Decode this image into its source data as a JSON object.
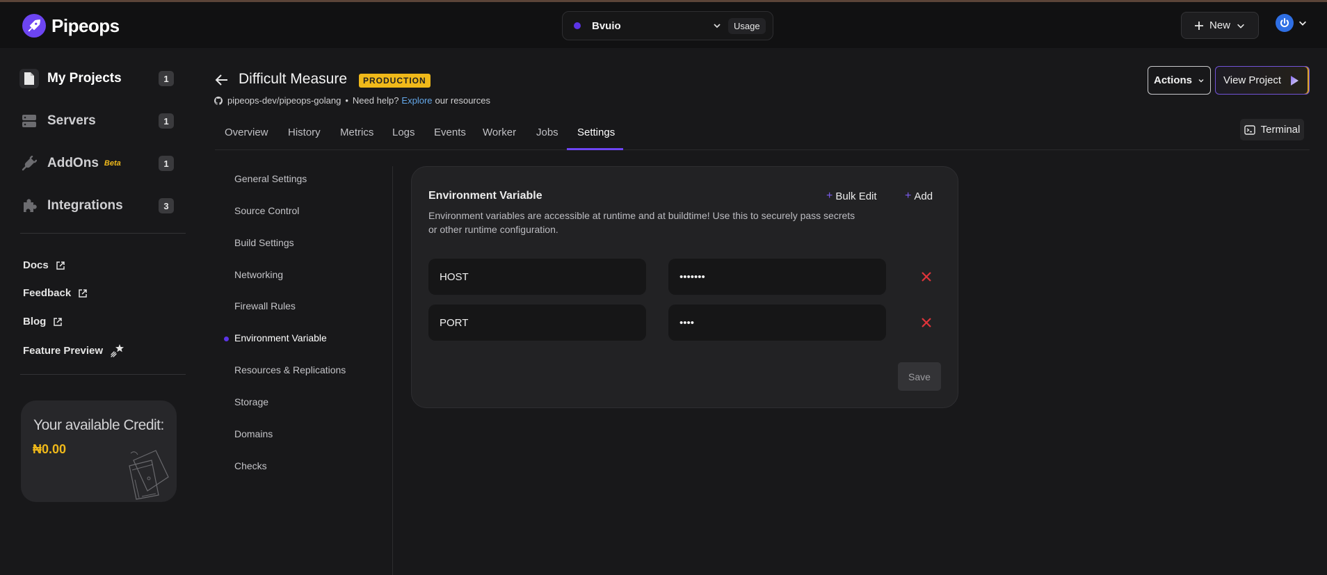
{
  "app": {
    "name": "Pipeops"
  },
  "header": {
    "workspace": "Bvuio",
    "usage_label": "Usage",
    "new_label": "New"
  },
  "sidebar": {
    "items": [
      {
        "label": "My Projects",
        "count": "1"
      },
      {
        "label": "Servers",
        "count": "1"
      },
      {
        "label": "AddOns",
        "badge": "Beta",
        "count": "1"
      },
      {
        "label": "Integrations",
        "count": "3"
      }
    ],
    "links": [
      {
        "label": "Docs"
      },
      {
        "label": "Feedback"
      },
      {
        "label": "Blog"
      },
      {
        "label": "Feature Preview"
      }
    ],
    "credit": {
      "title": "Your available Credit:",
      "value": "₦0.00"
    }
  },
  "project": {
    "title": "Difficult Measure",
    "env_badge": "PRODUCTION",
    "repo": "pipeops-dev/pipeops-golang",
    "help_prefix": "Need help?",
    "help_link": "Explore",
    "help_suffix": "our resources",
    "actions_label": "Actions",
    "view_label": "View Project",
    "terminal_label": "Terminal"
  },
  "tabs": [
    {
      "label": "Overview"
    },
    {
      "label": "History"
    },
    {
      "label": "Metrics"
    },
    {
      "label": "Logs"
    },
    {
      "label": "Events"
    },
    {
      "label": "Worker"
    },
    {
      "label": "Jobs"
    },
    {
      "label": "Settings",
      "active": true
    }
  ],
  "settings_menu": [
    {
      "label": "General Settings"
    },
    {
      "label": "Source Control"
    },
    {
      "label": "Build Settings"
    },
    {
      "label": "Networking"
    },
    {
      "label": "Firewall Rules"
    },
    {
      "label": "Environment Variable",
      "active": true
    },
    {
      "label": "Resources & Replications"
    },
    {
      "label": "Storage"
    },
    {
      "label": "Domains"
    },
    {
      "label": "Checks"
    }
  ],
  "env": {
    "title": "Environment Variable",
    "description": "Environment variables are accessible at runtime and at buildtime! Use this to securely pass secrets or other runtime configuration.",
    "bulk_edit_label": "Bulk Edit",
    "add_label": "Add",
    "save_label": "Save",
    "variables": [
      {
        "key": "HOST",
        "value": "•••••••"
      },
      {
        "key": "PORT",
        "value": "••••"
      }
    ]
  },
  "colors": {
    "accent": "#6d45f2",
    "badge": "#f0b91a",
    "danger": "#e0343a",
    "link": "#64a8ea"
  }
}
